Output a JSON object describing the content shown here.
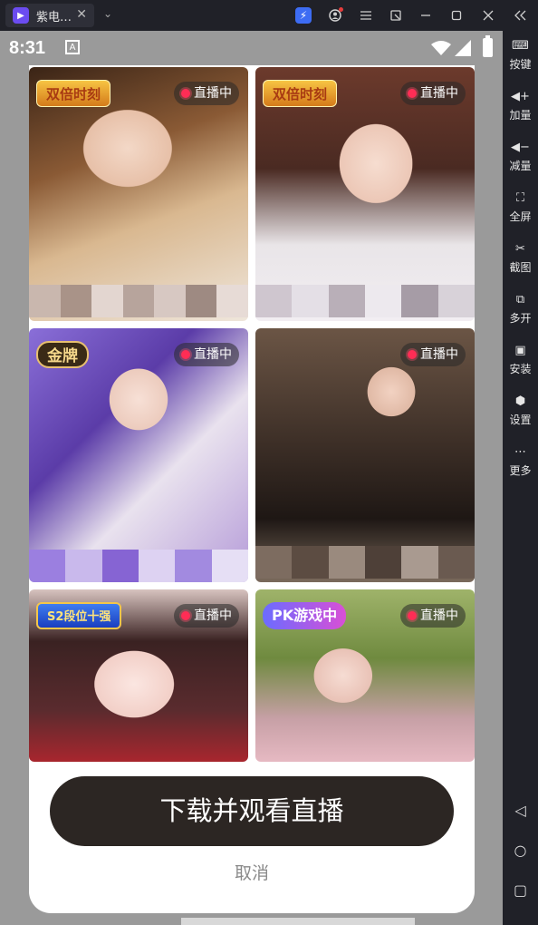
{
  "titlebar": {
    "tab_title": "紫电…",
    "tab_close": "✕",
    "dropdown": "⌄"
  },
  "statusbar": {
    "time": "8:31",
    "notif_icon": "A"
  },
  "sidebar": {
    "items": [
      {
        "label": "按键",
        "icon": "keyboard-icon"
      },
      {
        "label": "加量",
        "icon": "volume-up-icon"
      },
      {
        "label": "减量",
        "icon": "volume-down-icon"
      },
      {
        "label": "全屏",
        "icon": "fullscreen-icon"
      },
      {
        "label": "截图",
        "icon": "scissors-icon"
      },
      {
        "label": "多开",
        "icon": "multi-instance-icon"
      },
      {
        "label": "安装",
        "icon": "apk-install-icon"
      },
      {
        "label": "设置",
        "icon": "settings-icon"
      },
      {
        "label": "更多",
        "icon": "more-icon"
      }
    ],
    "nav": [
      "◁",
      "○",
      "▢"
    ]
  },
  "tiles": [
    {
      "live": "直播中",
      "tag": "双倍时刻"
    },
    {
      "live": "直播中",
      "tag": "双倍时刻"
    },
    {
      "live": "直播中",
      "tag": "金牌"
    },
    {
      "live": "直播中",
      "tag": ""
    },
    {
      "live": "直播中",
      "tag": "S2段位十强"
    },
    {
      "live": "直播中",
      "tag": "PK游戏中"
    }
  ],
  "cta": {
    "download_label": "下载并观看直播",
    "cancel_label": "取消"
  }
}
